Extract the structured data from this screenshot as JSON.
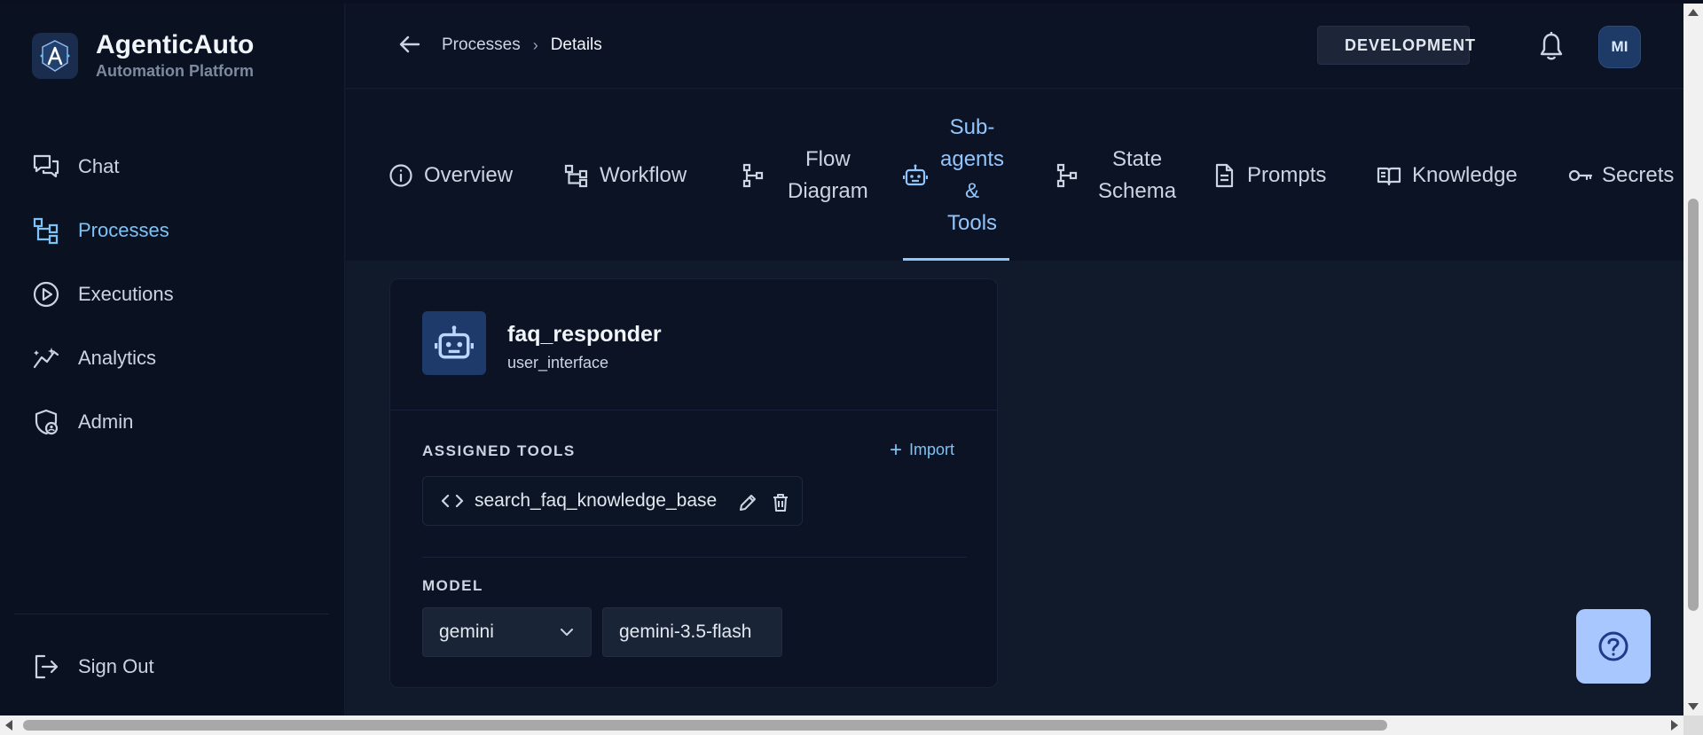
{
  "brand": {
    "name": "AgenticAuto",
    "subtitle": "Automation Platform"
  },
  "sidebar": {
    "items": [
      {
        "label": "Chat",
        "icon": "chat-icon",
        "active": false
      },
      {
        "label": "Processes",
        "icon": "processes-icon",
        "active": true
      },
      {
        "label": "Executions",
        "icon": "play-circle-icon",
        "active": false
      },
      {
        "label": "Analytics",
        "icon": "analytics-icon",
        "active": false
      },
      {
        "label": "Admin",
        "icon": "shield-user-icon",
        "active": false
      }
    ],
    "signout_label": "Sign Out"
  },
  "header": {
    "breadcrumb": {
      "parent": "Processes",
      "separator": "›",
      "current": "Details"
    },
    "environment": "DEVELOPMENT",
    "avatar_initials": "MI"
  },
  "tabs": [
    {
      "label": "Overview",
      "icon": "info-icon",
      "active": false
    },
    {
      "label": "Workflow",
      "icon": "workflow-icon",
      "active": false
    },
    {
      "label": "Flow\nDiagram",
      "icon": "flow-diagram-icon",
      "active": false
    },
    {
      "label": "Sub-\nagents\n&\nTools",
      "icon": "robot-icon",
      "active": true
    },
    {
      "label": "State\nSchema",
      "icon": "schema-icon",
      "active": false
    },
    {
      "label": "Prompts",
      "icon": "document-icon",
      "active": false
    },
    {
      "label": "Knowledge",
      "icon": "book-icon",
      "active": false
    },
    {
      "label": "Secrets",
      "icon": "key-icon",
      "active": false
    }
  ],
  "agent": {
    "name": "faq_responder",
    "type": "user_interface",
    "assigned_tools_label": "ASSIGNED TOOLS",
    "import_label": "Import",
    "tools": [
      {
        "name": "search_faq_knowledge_base"
      }
    ],
    "model_label": "MODEL",
    "provider": "gemini",
    "model": "gemini-3.5-flash"
  },
  "colors": {
    "accent": "#7dc3f5",
    "active_tab": "#93c5fd",
    "help_button": "#a9c7ff",
    "env_dot": "#5cc6f2"
  }
}
